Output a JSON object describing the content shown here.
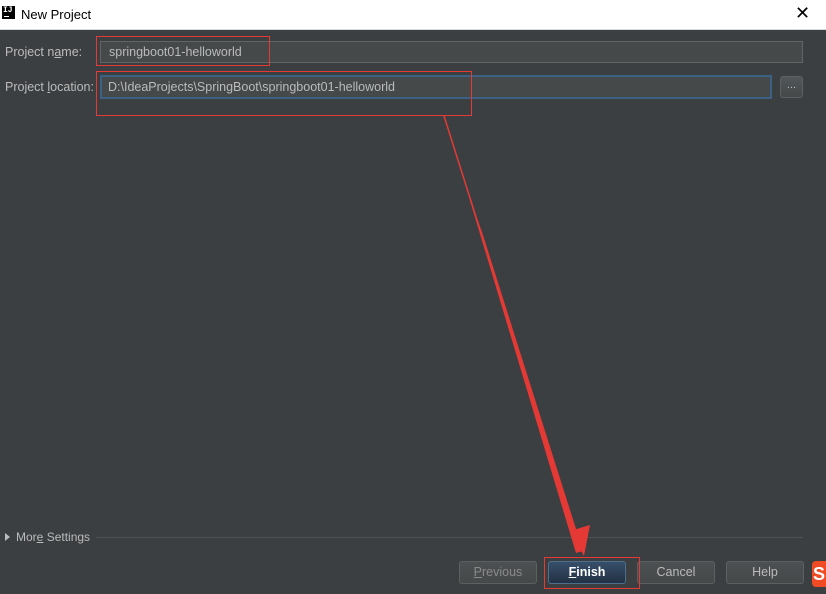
{
  "window": {
    "title": "New Project",
    "app_icon_text": "IJ",
    "close_glyph": "✕"
  },
  "form": {
    "project_name": {
      "label_prefix": "Project n",
      "label_mnemonic": "a",
      "label_suffix": "me:",
      "value": "springboot01-helloworld"
    },
    "project_location": {
      "label_prefix": "Project ",
      "label_mnemonic": "l",
      "label_suffix": "ocation:",
      "value": "D:\\IdeaProjects\\SpringBoot\\springboot01-helloworld"
    },
    "browse_label": "..."
  },
  "more_settings": {
    "label_prefix": "Mor",
    "label_mnemonic": "e",
    "label_suffix": " Settings"
  },
  "buttons": {
    "previous": {
      "mnemonic": "P",
      "rest": "revious"
    },
    "finish": {
      "mnemonic": "F",
      "rest": "inish"
    },
    "cancel": "Cancel",
    "help": "Help"
  },
  "annotation": {
    "color": "#e53935",
    "icon": "red-arrow-icon"
  },
  "sogou_glyph": "S"
}
